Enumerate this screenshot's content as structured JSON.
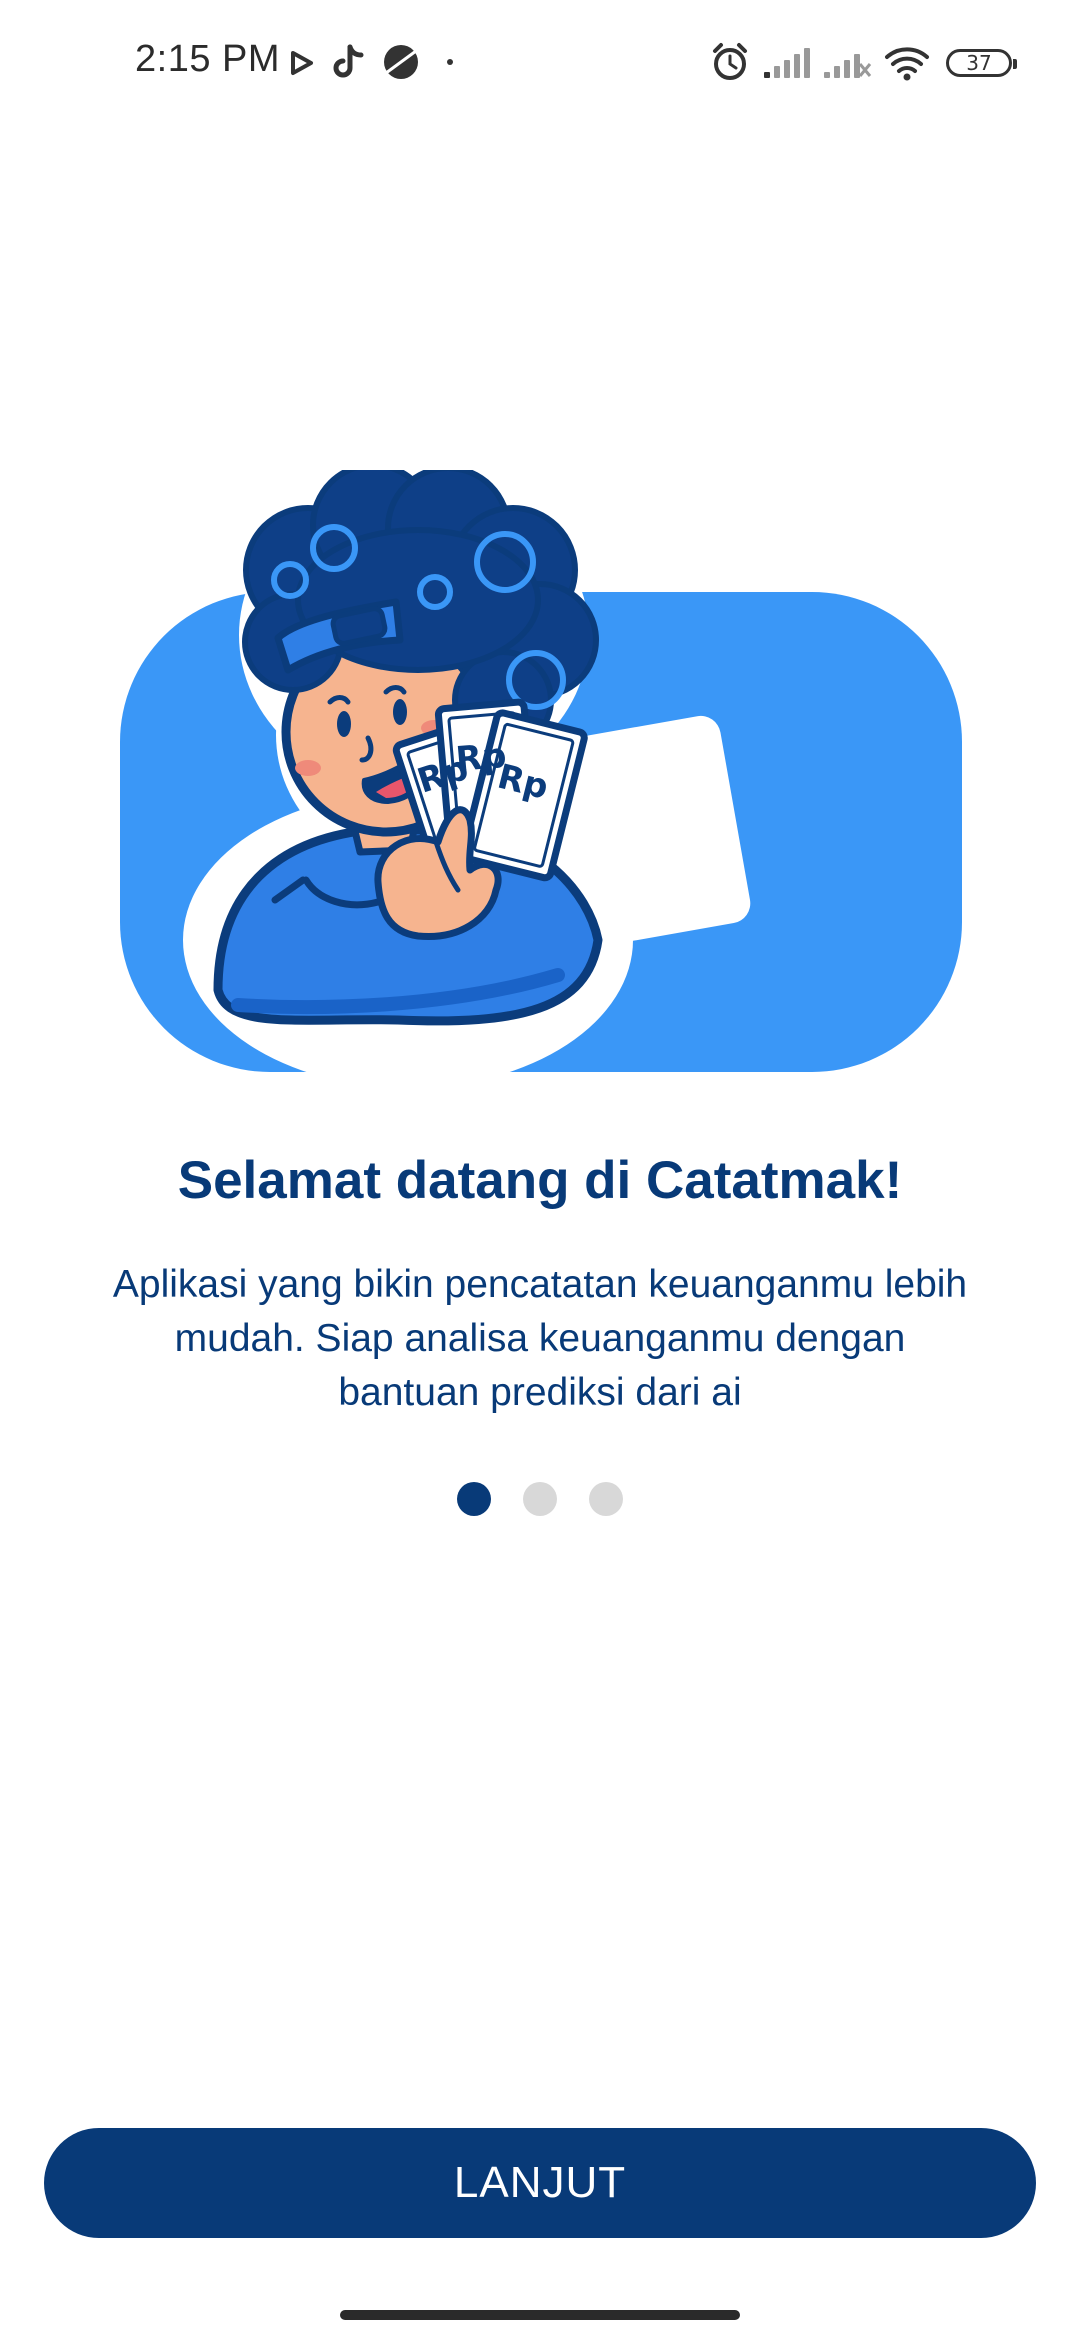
{
  "status_bar": {
    "time": "2:15 PM",
    "battery": "37",
    "left_icons": [
      "play-icon",
      "tiktok-icon",
      "browser-icon",
      "dot-icon"
    ],
    "right_icons": [
      "alarm-icon",
      "signal-icon",
      "signal-x-icon",
      "wifi-icon",
      "battery-icon"
    ]
  },
  "onboarding": {
    "illustration": "mascot-holding-money",
    "money_label": "Rp",
    "title": "Selamat datang di Catatmak!",
    "description": "Aplikasi yang bikin pencatatan keuanganmu lebih mudah. Siap analisa keuanganmu dengan bantuan prediksi dari ai",
    "page_indicator": {
      "count": 3,
      "active": 1
    },
    "next_button": "LANJUT"
  },
  "colors": {
    "primary": "#083a78",
    "accent": "#3a97f7",
    "dot_inactive": "#d8d8d8"
  }
}
